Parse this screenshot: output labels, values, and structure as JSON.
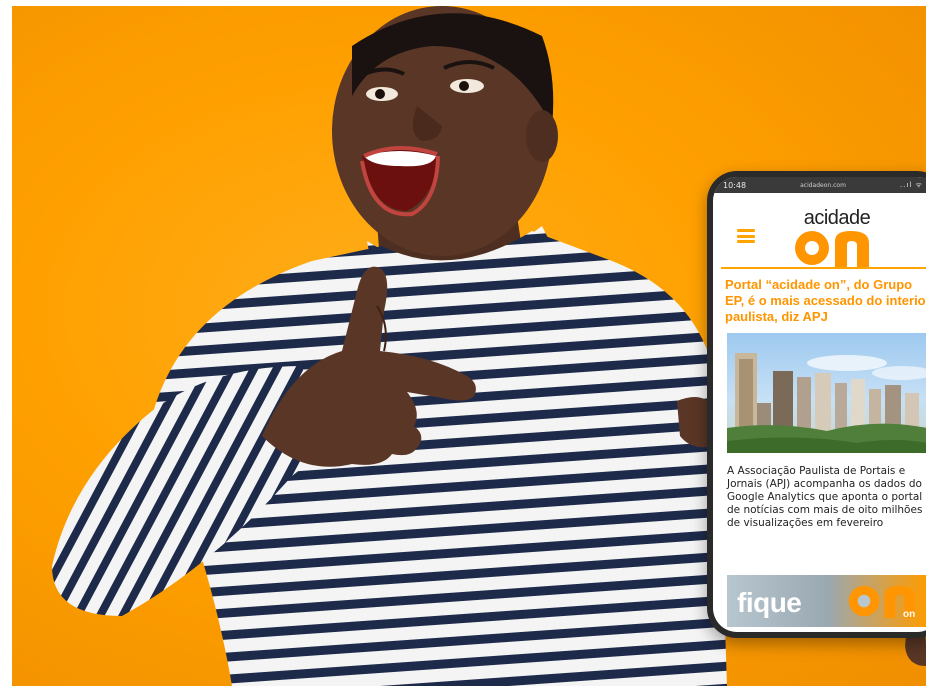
{
  "phone": {
    "status_time": "10:48",
    "url": "acidadeon.com",
    "status_icons": "..ıl ᯤ ▮",
    "brand_top": "acidade",
    "brand_bottom": "on",
    "menu_icon": "hamburger-icon",
    "headline": "Portal “acidade on”, do Grupo EP, é o mais acessado do interior paulista, diz APJ",
    "article_body": "A Associação Paulista de Portais e Jornais (APJ) acompanha os dados do Google Analytics que aponta o portal de notícias com mais de oito milhões de visualizações em fevereiro",
    "promo_text": "fique",
    "promo_logo_text": "on"
  },
  "colors": {
    "background_orange": "#ffa000",
    "brand_orange": "#ff9500",
    "stripe_navy": "#1e2a4a",
    "shirt_white": "#f5f5f5",
    "skin": "#5a3626"
  }
}
